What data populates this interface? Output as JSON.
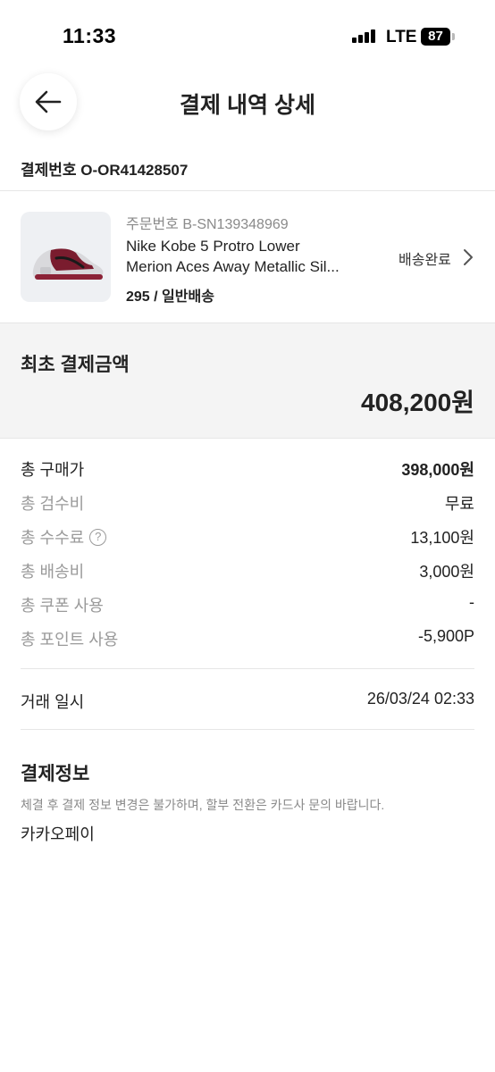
{
  "status_bar": {
    "time": "11:33",
    "network": "LTE",
    "battery": "87"
  },
  "header": {
    "title": "결제 내역 상세",
    "back_icon": "arrow-left-icon"
  },
  "payment_number": "결제번호 O-OR41428507",
  "product": {
    "order_number": "주문번호 B-SN139348969",
    "name_line1": "Nike Kobe 5 Protro Lower",
    "name_line2": "Merion Aces Away Metallic Sil...",
    "option": "295 / 일반배송",
    "status": "배송완료",
    "status_icon": "chevron-right-icon"
  },
  "total": {
    "label": "최초 결제금액",
    "amount": "408,200원"
  },
  "breakdown": [
    {
      "label": "총 구매가",
      "value": "398,000원"
    },
    {
      "label": "총 검수비",
      "value": "무료"
    },
    {
      "label": "총 수수료",
      "value": "13,100원"
    },
    {
      "label": "총 배송비",
      "value": "3,000원"
    },
    {
      "label": "총 쿠폰 사용",
      "value": "-"
    },
    {
      "label": "총 포인트 사용",
      "value": "-5,900P"
    }
  ],
  "trade": {
    "label": "거래 일시",
    "value": "26/03/24 02:33"
  },
  "payment_info": {
    "title": "결제정보",
    "note": "체결 후 결제 정보 변경은 불가하며, 할부 전환은 카드사 문의 바랍니다.",
    "method": "카카오페이"
  },
  "colors": {
    "text_primary": "#222222",
    "text_secondary": "#9a9a9a",
    "total_background": "#f4f4f4",
    "divider": "#e6e6e6"
  }
}
